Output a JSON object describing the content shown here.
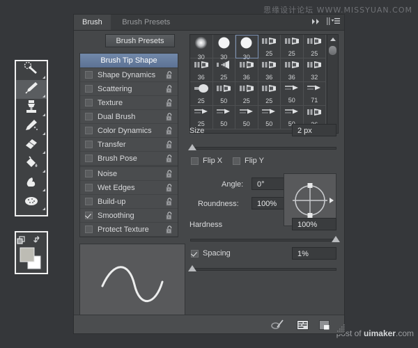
{
  "app": {
    "panel_title": "Brush",
    "watermark_top": "思缘设计论坛  WWW.MISSYUAN.COM",
    "watermark_bottom_prefix": "post of ",
    "watermark_bottom_brand": "uimaker",
    "watermark_bottom_suffix": ".com"
  },
  "colors": {
    "panel_bg": "#454749",
    "panel_dark": "#3c3e40",
    "selection_blue": "#6e84a6",
    "text": "#d9dadc",
    "field_bg": "#3a3c3e"
  },
  "tabs": [
    {
      "label": "Brush",
      "active": true
    },
    {
      "label": "Brush Presets",
      "active": false
    }
  ],
  "header_icons": [
    {
      "name": "collapse-double-arrow-icon"
    },
    {
      "name": "panel-menu-icon"
    }
  ],
  "preset_button": {
    "label": "Brush Presets"
  },
  "options": {
    "header": "Brush Tip Shape",
    "items": [
      {
        "label": "Shape Dynamics",
        "checked": false,
        "locked": true,
        "gap_after": false
      },
      {
        "label": "Scattering",
        "checked": false,
        "locked": true,
        "gap_after": false
      },
      {
        "label": "Texture",
        "checked": false,
        "locked": true,
        "gap_after": false
      },
      {
        "label": "Dual Brush",
        "checked": false,
        "locked": true,
        "gap_after": false
      },
      {
        "label": "Color Dynamics",
        "checked": false,
        "locked": true,
        "gap_after": false
      },
      {
        "label": "Transfer",
        "checked": false,
        "locked": true,
        "gap_after": false
      },
      {
        "label": "Brush Pose",
        "checked": false,
        "locked": true,
        "gap_after": true
      },
      {
        "label": "Noise",
        "checked": false,
        "locked": true,
        "gap_after": false
      },
      {
        "label": "Wet Edges",
        "checked": false,
        "locked": true,
        "gap_after": false
      },
      {
        "label": "Build-up",
        "checked": false,
        "locked": true,
        "gap_after": false
      },
      {
        "label": "Smoothing",
        "checked": true,
        "locked": true,
        "gap_after": false
      },
      {
        "label": "Protect Texture",
        "checked": false,
        "locked": true,
        "gap_after": false
      }
    ]
  },
  "brush_grid": {
    "selected_index": 2,
    "cells": [
      {
        "size": "30",
        "shape": "soft-round"
      },
      {
        "size": "30",
        "shape": "hard-round"
      },
      {
        "size": "30",
        "shape": "hard-round"
      },
      {
        "size": "25",
        "shape": "flat-tip"
      },
      {
        "size": "25",
        "shape": "flat-tip"
      },
      {
        "size": "25",
        "shape": "flat-tip"
      },
      {
        "size": "36",
        "shape": "flat-tip"
      },
      {
        "size": "25",
        "shape": "fan-tip"
      },
      {
        "size": "36",
        "shape": "flat-tip"
      },
      {
        "size": "36",
        "shape": "flat-tip"
      },
      {
        "size": "36",
        "shape": "flat-tip"
      },
      {
        "size": "32",
        "shape": "flat-tip"
      },
      {
        "size": "25",
        "shape": "round-tip"
      },
      {
        "size": "50",
        "shape": "flat-tip"
      },
      {
        "size": "25",
        "shape": "flat-tip"
      },
      {
        "size": "25",
        "shape": "flat-tip"
      },
      {
        "size": "50",
        "shape": "thin-tip"
      },
      {
        "size": "71",
        "shape": "thin-tip"
      },
      {
        "size": "25",
        "shape": "thin-tip"
      },
      {
        "size": "50",
        "shape": "thin-tip"
      },
      {
        "size": "50",
        "shape": "thin-tip"
      },
      {
        "size": "50",
        "shape": "thin-tip"
      },
      {
        "size": "50",
        "shape": "thin-tip"
      },
      {
        "size": "36",
        "shape": "flat-tip"
      }
    ]
  },
  "controls": {
    "size": {
      "label": "Size",
      "value": "2 px",
      "slider_percent": 1
    },
    "flip_x": {
      "label": "Flip X",
      "checked": false
    },
    "flip_y": {
      "label": "Flip Y",
      "checked": false
    },
    "angle": {
      "label": "Angle:",
      "value": "0°"
    },
    "roundness": {
      "label": "Roundness:",
      "value": "100%"
    },
    "hardness": {
      "label": "Hardness",
      "value": "100%",
      "slider_percent": 100
    },
    "spacing": {
      "label": "Spacing",
      "value": "1%",
      "checked": true,
      "slider_percent": 1
    }
  },
  "footer_icons": [
    {
      "name": "toggle-brush-preview-icon"
    },
    {
      "name": "brush-preset-panel-icon"
    },
    {
      "name": "new-brush-icon"
    },
    {
      "name": "resize-grip-icon"
    }
  ],
  "toolbar": {
    "tools": [
      {
        "name": "spot-healing-brush-tool",
        "selected": false
      },
      {
        "name": "brush-tool",
        "selected": true
      },
      {
        "name": "clone-stamp-tool",
        "selected": false
      },
      {
        "name": "history-brush-tool",
        "selected": false
      },
      {
        "name": "eraser-tool",
        "selected": false
      },
      {
        "name": "paint-bucket-tool",
        "selected": false
      },
      {
        "name": "smudge-tool",
        "selected": false
      },
      {
        "name": "sponge-tool",
        "selected": false
      }
    ]
  },
  "color_swatches": {
    "foreground": "#bdbcb4",
    "background": "#ffffff",
    "default_icon": "default-colors-icon",
    "swap_icon": "swap-colors-icon"
  }
}
